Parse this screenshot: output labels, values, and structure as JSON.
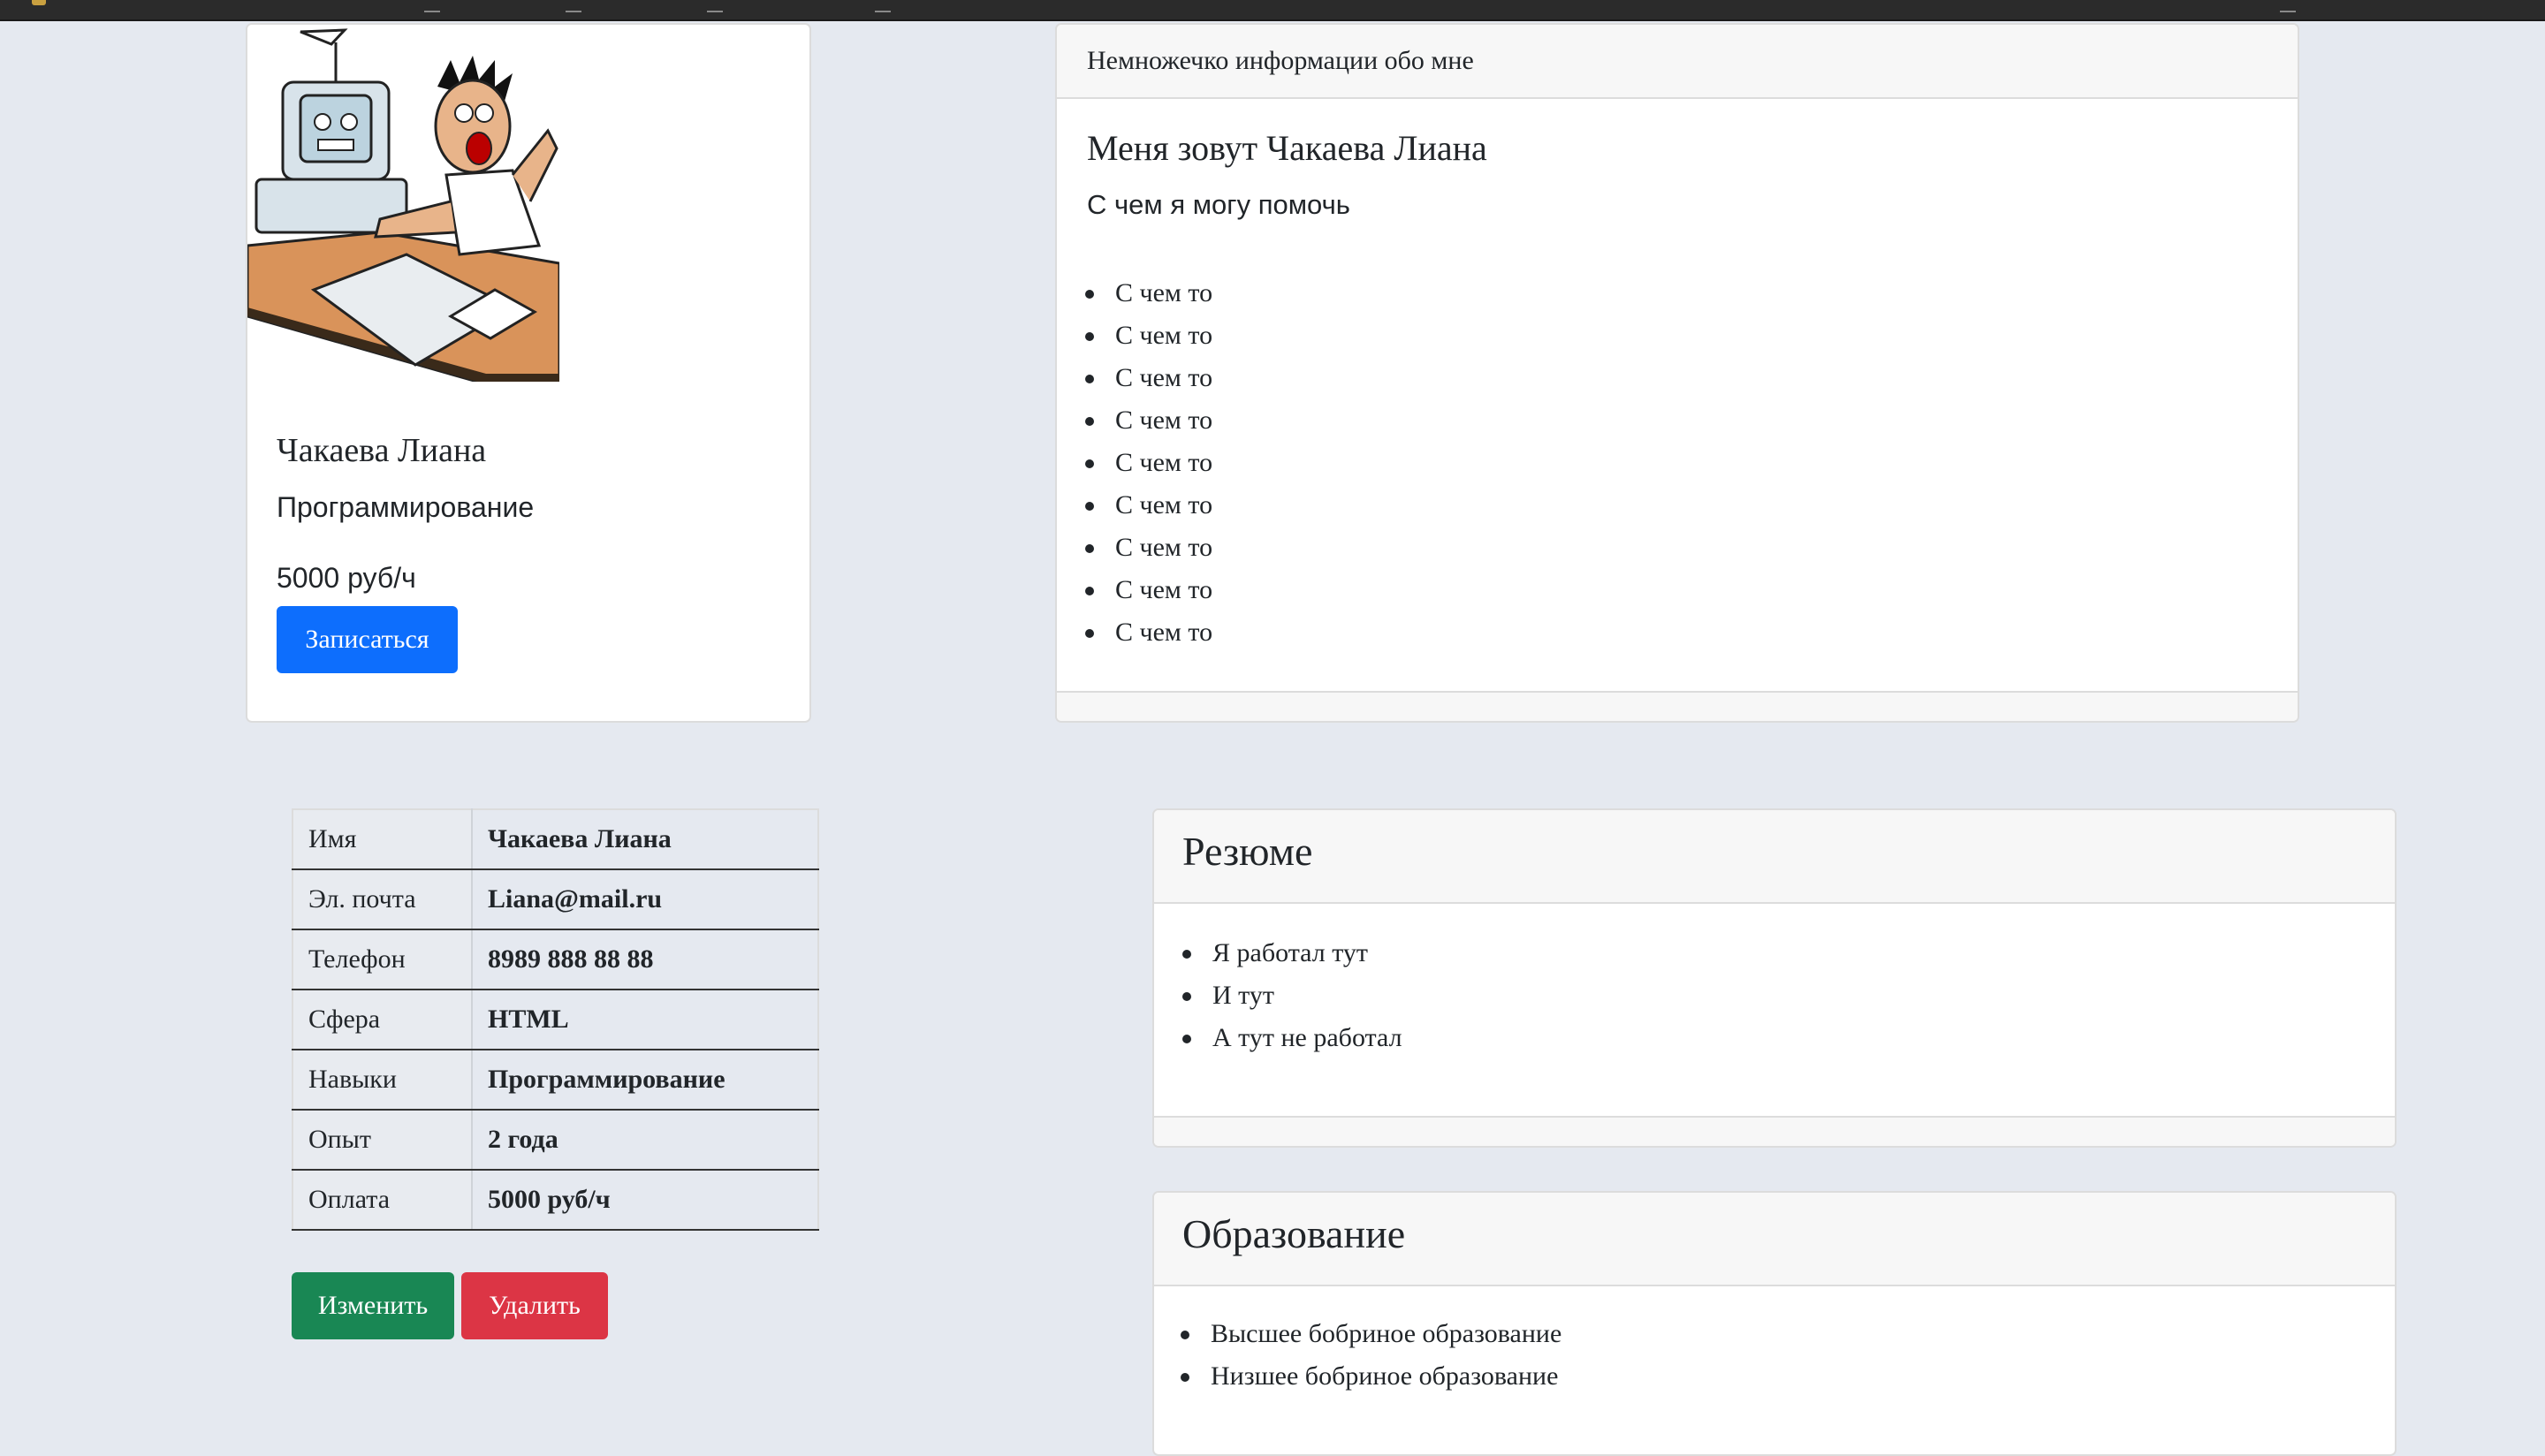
{
  "profile": {
    "name": "Чакаева Лиана",
    "subject": "Программирование",
    "price": "5000 руб/ч",
    "signup_label": "Записаться"
  },
  "about": {
    "header": "Немножечко информации обо мне",
    "title": "Меня зовут Чакаева Лиана",
    "subtitle": "С чем я могу помочь",
    "items": [
      "С чем то",
      "С чем то",
      "С чем то",
      "С чем то",
      "С чем то",
      "С чем то",
      "С чем то",
      "С чем то",
      "С чем то"
    ]
  },
  "info_table": {
    "rows": [
      {
        "label": "Имя",
        "value": "Чакаева Лиана"
      },
      {
        "label": "Эл. почта",
        "value": "Liana@mail.ru"
      },
      {
        "label": "Телефон",
        "value": "8989 888 88 88"
      },
      {
        "label": "Сфера",
        "value": "HTML"
      },
      {
        "label": "Навыки",
        "value": "Программирование"
      },
      {
        "label": "Опыт",
        "value": "2 года"
      },
      {
        "label": "Оплата",
        "value": "5000 руб/ч"
      }
    ],
    "edit_label": "Изменить",
    "delete_label": "Удалить"
  },
  "resume": {
    "title": "Резюме",
    "items": [
      "Я работал тут",
      "И тут",
      "А тут не работал"
    ]
  },
  "education": {
    "title": "Образование",
    "items": [
      "Высшее бобриное образование",
      "Низшее бобриное образование"
    ]
  },
  "colors": {
    "primary": "#0d6efd",
    "success": "#198754",
    "danger": "#dc3545",
    "page_bg": "#e5e9f0"
  }
}
